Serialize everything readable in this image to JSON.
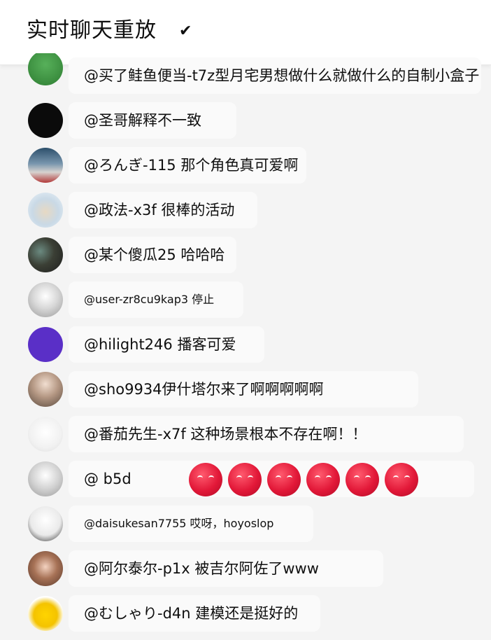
{
  "header": {
    "title": "实时聊天重放",
    "check_icon": "✔"
  },
  "messages": [
    {
      "text": "@买了鲑鱼便当-t7z型月宅男想做什么就做什么的自制小盒子",
      "avatar": "green-avatar"
    },
    {
      "text": "@圣哥解释不一致",
      "avatar": "black-avatar"
    },
    {
      "text": "@ろんぎ-115 那个角色真可爱啊",
      "avatar": "photo-avatar"
    },
    {
      "text": "@政法-x3f 很棒的活动",
      "avatar": "bowl-avatar"
    },
    {
      "text": "@某个傻瓜25 哈哈哈",
      "avatar": "dark-photo-avatar"
    },
    {
      "text": "@user-zr8cu9kap3 停止",
      "avatar": "sketch-avatar"
    },
    {
      "text": "@hilight246 播客可爱",
      "avatar": "purple-avatar"
    },
    {
      "text": "@sho9934伊什塔尔来了啊啊啊啊啊",
      "avatar": "character-avatar"
    },
    {
      "text": "@番茄先生-x7f 这种场景根本不存在啊！！",
      "avatar": "white-cat-avatar"
    },
    {
      "text": "@ b5d",
      "avatar": "sketch-avatar-2",
      "emoji_count": 6
    },
    {
      "text": "@daisukesan7755 哎呀，hoyoslop",
      "avatar": "chibi-avatar"
    },
    {
      "text": "@阿尔泰尔-p1x 被吉尔阿佐了www",
      "avatar": "anime-avatar"
    },
    {
      "text": "@むしゃり-d4n 建模还是挺好的",
      "avatar": "yellow-avatar"
    }
  ],
  "colors": {
    "background": "#f4f4f4",
    "header": "#ffffff",
    "emoji": "#e21838"
  }
}
